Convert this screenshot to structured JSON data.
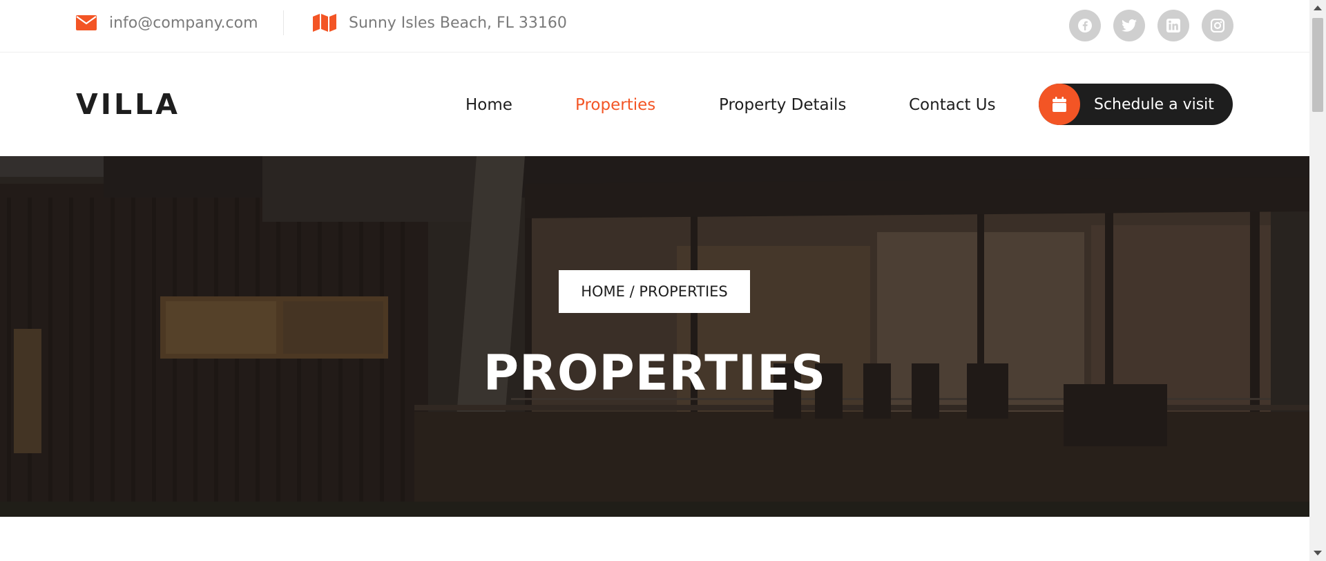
{
  "topbar": {
    "email": "info@company.com",
    "address": "Sunny Isles Beach, FL 33160",
    "email_icon": "envelope-icon",
    "address_icon": "map-icon",
    "social": [
      "facebook-icon",
      "twitter-icon",
      "linkedin-icon",
      "instagram-icon"
    ]
  },
  "header": {
    "logo": "VILLA",
    "nav": {
      "home": "Home",
      "properties": "Properties",
      "property_details": "Property Details",
      "contact": "Contact Us"
    },
    "active_nav": "properties",
    "cta_label": "Schedule a visit",
    "cta_icon": "calendar-icon"
  },
  "hero": {
    "breadcrumb": "HOME / PROPERTIES",
    "title": "PROPERTIES"
  },
  "colors": {
    "accent": "#f35525",
    "dark": "#1e1e1e",
    "muted_text": "#7a7a7a",
    "social_circle": "#cfcfcf"
  }
}
